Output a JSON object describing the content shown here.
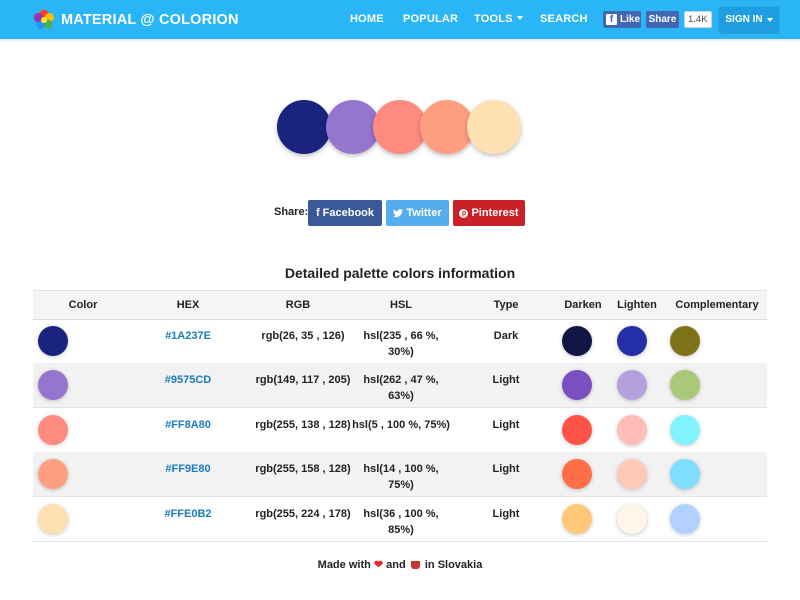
{
  "nav": {
    "brand": "MATERIAL @ COLORION",
    "links": [
      "HOME",
      "POPULAR",
      "TOOLS",
      "SEARCH"
    ],
    "fb_like": "Like",
    "fb_share": "Share",
    "fb_count": "1.4K",
    "signin": "SIGN IN"
  },
  "palette": [
    "#1A237E",
    "#9575CD",
    "#FF8A80",
    "#FF9E80",
    "#FFE0B2"
  ],
  "share": {
    "label": "Share:",
    "facebook": "Facebook",
    "twitter": "Twitter",
    "pinterest": "Pinterest"
  },
  "section_title": "Detailed palette colors information",
  "table": {
    "headers": [
      "Color",
      "HEX",
      "RGB",
      "HSL",
      "Type",
      "Darken",
      "Lighten",
      "Complementary"
    ],
    "rows": [
      {
        "color": "#1A237E",
        "hex": "#1A237E",
        "rgb": "rgb(26, 35 , 126)",
        "hsl1": "hsl(235 , 66 %,",
        "hsl2": "30%)",
        "type": "Dark",
        "darken": "#111745",
        "lighten": "#2530A8",
        "comp": "#7E7219"
      },
      {
        "color": "#9575CD",
        "hex": "#9575CD",
        "rgb": "rgb(149, 117 , 205)",
        "hsl1": "hsl(262 , 47 %,",
        "hsl2": "63%)",
        "type": "Light",
        "darken": "#7B4FC0",
        "lighten": "#B5A0DE",
        "comp": "#A9C979"
      },
      {
        "color": "#FF8A80",
        "hex": "#FF8A80",
        "rgb": "rgb(255, 138 , 128)",
        "hsl1": "hsl(5 , 100 %, 75%)",
        "hsl2": "",
        "type": "Light",
        "darken": "#FF5347",
        "lighten": "#FFBDB7",
        "comp": "#80F5FF"
      },
      {
        "color": "#FF9E80",
        "hex": "#FF9E80",
        "rgb": "rgb(255, 158 , 128)",
        "hsl1": "hsl(14 , 100 %,",
        "hsl2": "75%)",
        "type": "Light",
        "darken": "#FF6E47",
        "lighten": "#FFC8B7",
        "comp": "#80DEFF"
      },
      {
        "color": "#FFE0B2",
        "hex": "#FFE0B2",
        "rgb": "rgb(255, 224 , 178)",
        "hsl1": "hsl(36 , 100 %,",
        "hsl2": "85%)",
        "type": "Light",
        "darken": "#FFC878",
        "lighten": "#FFF6E8",
        "comp": "#B2D1FF"
      }
    ]
  },
  "footer": {
    "made_with": "Made with",
    "and": "and",
    "in": "in Slovakia"
  }
}
